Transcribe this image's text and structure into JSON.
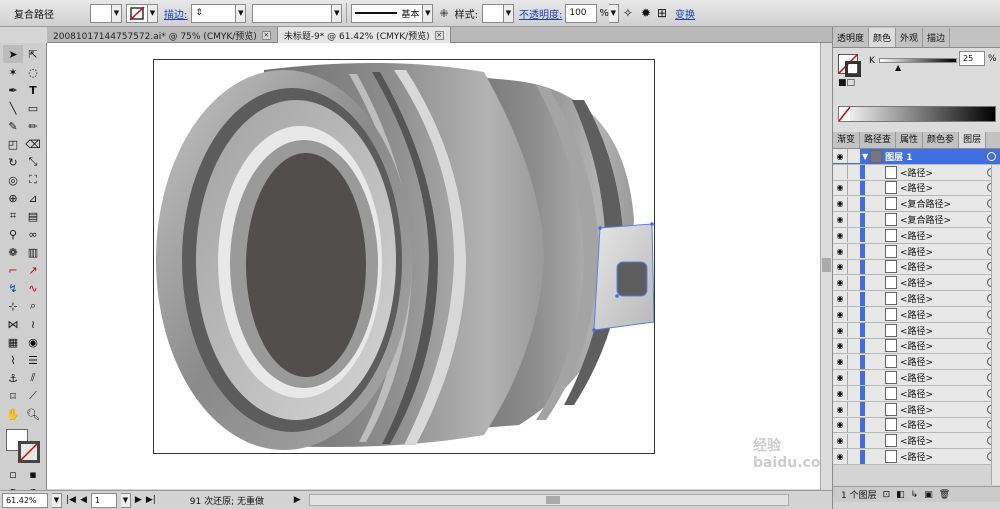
{
  "control": {
    "object_type": "复合路径",
    "stroke_link": "描边:",
    "stroke_profile": "基本",
    "style_label": "样式:",
    "opacity_link": "不透明度:",
    "opacity_value": "100",
    "opacity_unit": "%",
    "transform_link": "变换"
  },
  "tabs": [
    {
      "label": "20081017144757572.ai* @ 75% (CMYK/预览)"
    },
    {
      "label": "未标题-9* @ 61.42% (CMYK/预览)"
    }
  ],
  "status": {
    "zoom": "61.42%",
    "page": "1",
    "undo_info": "91 次还原; 无重做"
  },
  "color_panel": {
    "tabs": [
      "透明度",
      "颜色",
      "外观",
      "描边"
    ],
    "channel": "K",
    "value": "25",
    "unit": "%"
  },
  "layers_panel": {
    "tabs": [
      "渐变",
      "路径查",
      "属性",
      "颜色参",
      "图层"
    ],
    "layer_name": "图层 1",
    "items": [
      "<路径>",
      "<路径>",
      "<复合路径>",
      "<复合路径>",
      "<路径>",
      "<路径>",
      "<路径>",
      "<路径>",
      "<路径>",
      "<路径>",
      "<路径>",
      "<路径>",
      "<路径>",
      "<路径>",
      "<路径>",
      "<路径>",
      "<路径>",
      "<路径>",
      "<路径>"
    ],
    "footer": "1 个图层"
  },
  "watermark": "经验 baidu.com",
  "colors": {
    "selection_blue": "#3f6fe0",
    "link_blue": "#1a3fc0"
  }
}
